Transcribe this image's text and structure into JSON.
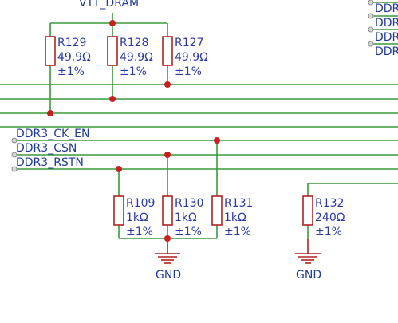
{
  "power_net": "VTT_DRAM",
  "net_labels": {
    "ck_en": "DDR3_CK_EN",
    "csn": "DDR3_CSN",
    "rstn": "DDR3_RSTN"
  },
  "right_labels": [
    "DDR",
    "DDR",
    "DDR",
    "DDR"
  ],
  "ground_label": "GND",
  "resistors": {
    "r129": {
      "ref": "R129",
      "value": "49.9Ω",
      "tol": "±1%"
    },
    "r128": {
      "ref": "R128",
      "value": "49.9Ω",
      "tol": "±1%"
    },
    "r127": {
      "ref": "R127",
      "value": "49.9Ω",
      "tol": "±1%"
    },
    "r109": {
      "ref": "R109",
      "value": "1kΩ",
      "tol": "±1%"
    },
    "r130": {
      "ref": "R130",
      "value": "1kΩ",
      "tol": "±1%"
    },
    "r131": {
      "ref": "R131",
      "value": "1kΩ",
      "tol": "±1%"
    },
    "r132": {
      "ref": "R132",
      "value": "240Ω",
      "tol": "±1%"
    }
  }
}
